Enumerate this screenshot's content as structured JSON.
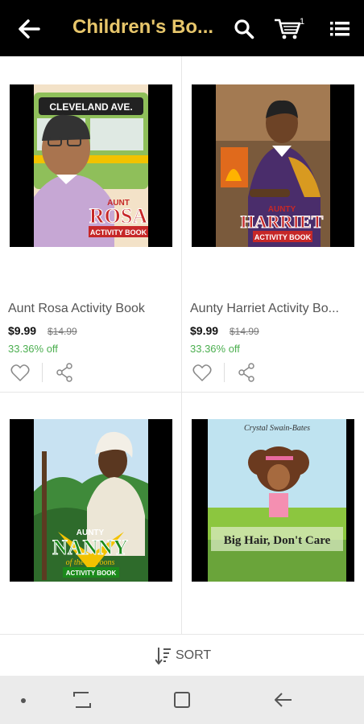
{
  "app_bar": {
    "title": "Children's Bo...",
    "cart_count": "1",
    "icons": [
      "back-arrow-icon",
      "search-icon",
      "cart-icon",
      "list-menu-icon"
    ]
  },
  "products": [
    {
      "name": "Aunt Rosa Activity Book",
      "price": "$9.99",
      "old_price": "$14.99",
      "discount": "33.36% off",
      "cover_text": [
        "CLEVELAND AVE.",
        "AUNT",
        "ROSA",
        "ACTIVITY BOOK"
      ]
    },
    {
      "name": "Aunty Harriet Activity Bo...",
      "price": "$9.99",
      "old_price": "$14.99",
      "discount": "33.36% off",
      "cover_text": [
        "AUNTY",
        "HARRIET",
        "ACTIVITY BOOK"
      ]
    },
    {
      "name": "",
      "cover_text": [
        "AUNTY",
        "NANNY",
        "of the Maroons",
        "ACTIVITY BOOK"
      ]
    },
    {
      "name": "",
      "cover_text": [
        "Crystal Swain-Bates",
        "Big Hair, Don't Care"
      ]
    }
  ],
  "sort": {
    "label": "SORT"
  },
  "colors": {
    "accent": "#e7c66b",
    "discount": "#4caf50",
    "appbar": "#000000"
  }
}
